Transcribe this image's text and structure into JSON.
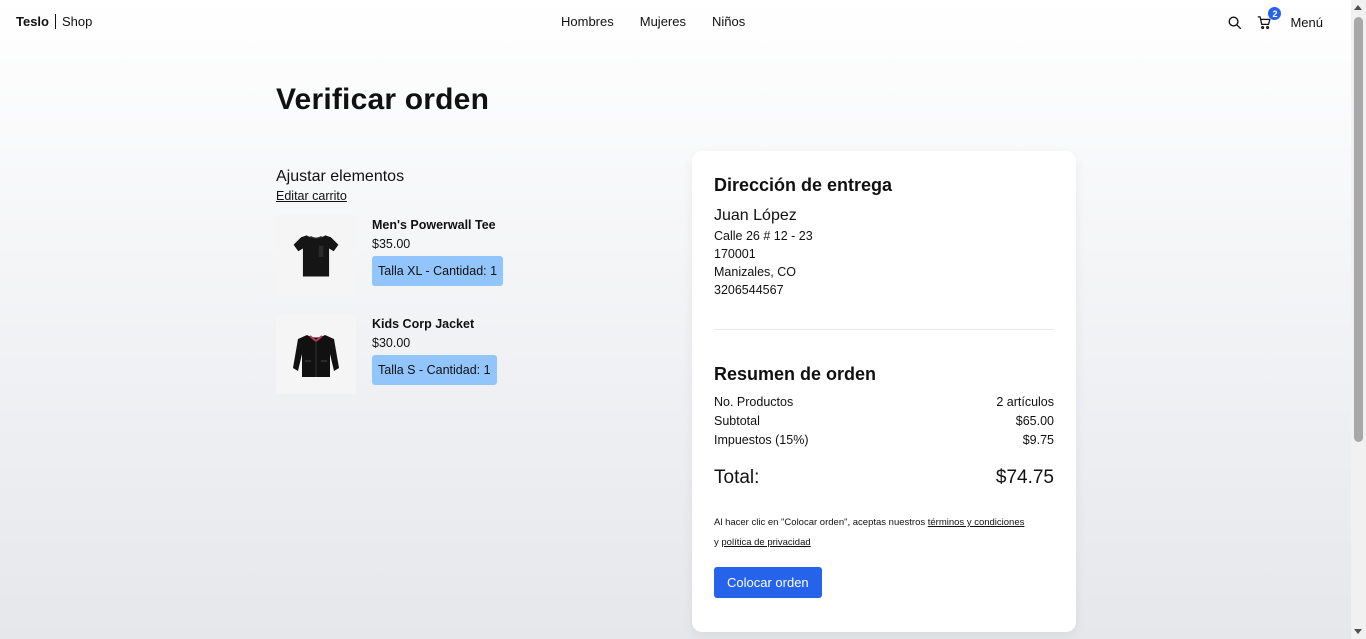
{
  "header": {
    "brand": "Teslo",
    "brand_sub": "Shop",
    "nav": [
      "Hombres",
      "Mujeres",
      "Niños"
    ],
    "cart_count": "2",
    "menu_label": "Menú",
    "icons": [
      "search-icon",
      "cart-icon"
    ]
  },
  "page": {
    "title": "Verificar orden"
  },
  "cart": {
    "title": "Ajustar elementos",
    "edit_link": "Editar carrito",
    "items": [
      {
        "name": "Men's Powerwall Tee",
        "price": "$35.00",
        "chip": "Talla XL - Cantidad: 1",
        "image": "tshirt-image"
      },
      {
        "name": "Kids Corp Jacket",
        "price": "$30.00",
        "chip": "Talla S - Cantidad: 1",
        "image": "jacket-image"
      }
    ]
  },
  "address": {
    "title": "Dirección de entrega",
    "name": "Juan López",
    "line1": "Calle 26 # 12 - 23",
    "postal": "170001",
    "city": "Manizales, CO",
    "phone": "3206544567"
  },
  "summary": {
    "title": "Resumen de orden",
    "products_label": "No. Productos",
    "products_value": "2 artículos",
    "subtotal_label": "Subtotal",
    "subtotal_value": "$65.00",
    "tax_label": "Impuestos (15%)",
    "tax_value": "$9.75",
    "total_label": "Total:",
    "total_value": "$74.75",
    "terms_prefix": "Al hacer clic en \"Colocar orden\", aceptas nuestros ",
    "terms_link": "términos y condiciones",
    "terms_mid": "y ",
    "privacy_link": "política de privacidad",
    "button_label": "Colocar orden"
  },
  "colors": {
    "accent": "#2563eb",
    "chip": "#93c5fd"
  }
}
